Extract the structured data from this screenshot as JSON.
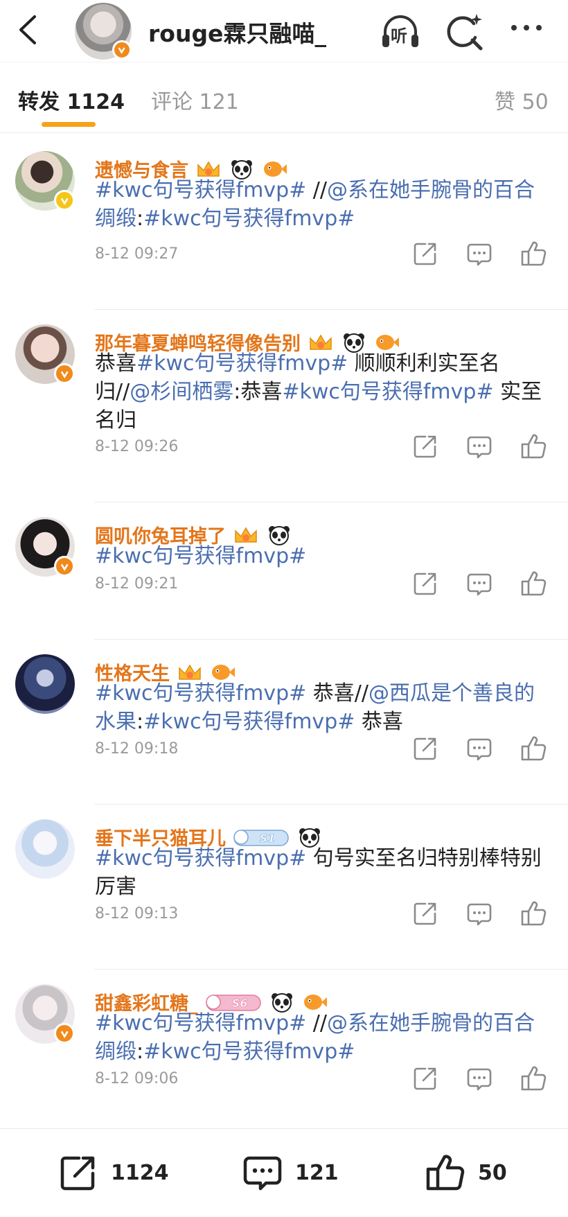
{
  "header": {
    "title": "rouge霖只融喵_",
    "listen_label": "听"
  },
  "tabs": {
    "repost_label": "转发",
    "repost_count": "1124",
    "comment_label": "评论",
    "comment_count": "121",
    "like_label": "赞",
    "like_count": "50"
  },
  "colors": {
    "accent": "#f7a21a",
    "username": "#e3761b",
    "hashtag": "#4a6eb0",
    "verify_orange": "#f08a1c",
    "verify_gold": "#f5c518"
  },
  "feed": [
    {
      "user": "遗憾与食言",
      "verify": "gold",
      "medals": [
        "crown-medal-icon",
        "panda-icon",
        "fish-icon"
      ],
      "content": [
        {
          "t": "#kwc句号获得fmvp#",
          "hl": true
        },
        {
          "t": " //",
          "hl": false
        },
        {
          "t": "@系在她手腕骨的百合绸缎",
          "hl": true
        },
        {
          "t": ":",
          "hl": false
        },
        {
          "t": "#kwc句号获得fmvp#",
          "hl": true
        }
      ],
      "time": "8-12 09:27"
    },
    {
      "user": "那年暮夏蝉鸣轻得像告别",
      "verify": "orange",
      "medals": [
        "crown-medal-icon",
        "panda-icon",
        "fish-icon"
      ],
      "content": [
        {
          "t": "恭喜",
          "hl": false
        },
        {
          "t": "#kwc句号获得fmvp#",
          "hl": true
        },
        {
          "t": " 顺顺利利实至名归//",
          "hl": false
        },
        {
          "t": "@杉间栖雾",
          "hl": true
        },
        {
          "t": ":恭喜",
          "hl": false
        },
        {
          "t": "#kwc句号获得fmvp#",
          "hl": true
        },
        {
          "t": " 实至名归",
          "hl": false
        }
      ],
      "time": "8-12 09:26"
    },
    {
      "user": "圆叽你兔耳掉了",
      "verify": "orange",
      "medals": [
        "crown-medal-icon",
        "panda-icon"
      ],
      "content": [
        {
          "t": "#kwc句号获得fmvp#",
          "hl": true
        }
      ],
      "time": "8-12 09:21"
    },
    {
      "user": "性格天生",
      "verify": "none",
      "medals": [
        "crown-medal-icon",
        "fish-icon"
      ],
      "content": [
        {
          "t": "#kwc句号获得fmvp#",
          "hl": true
        },
        {
          "t": " 恭喜//",
          "hl": false
        },
        {
          "t": "@西瓜是个善良的水果",
          "hl": true
        },
        {
          "t": ":",
          "hl": false
        },
        {
          "t": "#kwc句号获得fmvp#",
          "hl": true
        },
        {
          "t": " 恭喜",
          "hl": false
        }
      ],
      "time": "8-12 09:18"
    },
    {
      "user": "垂下半只猫耳儿",
      "verify": "none",
      "medals": [
        "s1-badge-icon",
        "panda-icon"
      ],
      "badge_text": "S1",
      "content": [
        {
          "t": "#kwc句号获得fmvp#",
          "hl": true
        },
        {
          "t": " 句号实至名归特别棒特别厉害",
          "hl": false
        }
      ],
      "time": "8-12 09:13"
    },
    {
      "user": "甜鑫彩虹糖_",
      "verify": "orange",
      "medals": [
        "s6-badge-icon",
        "panda-icon",
        "fish-icon"
      ],
      "badge_text": "S6",
      "content": [
        {
          "t": "#kwc句号获得fmvp#",
          "hl": true
        },
        {
          "t": " //",
          "hl": false
        },
        {
          "t": "@系在她手腕骨的百合绸缎",
          "hl": true
        },
        {
          "t": ":",
          "hl": false
        },
        {
          "t": "#kwc句号获得fmvp#",
          "hl": true
        }
      ],
      "time": "8-12 09:06"
    }
  ],
  "bottombar": {
    "repost_count": "1124",
    "comment_count": "121",
    "like_count": "50"
  }
}
